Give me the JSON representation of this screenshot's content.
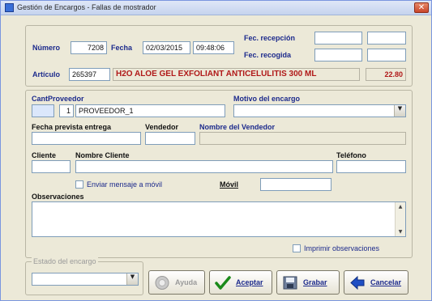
{
  "window": {
    "title": "Gestión de Encargos - Fallas de mostrador",
    "close_glyph": "✕"
  },
  "header": {
    "numero_label": "Número",
    "numero_value": "7208",
    "fecha_label": "Fecha",
    "fecha_date": "02/03/2015",
    "fecha_time": "09:48:06",
    "fec_recepcion_label": "Fec. recepción",
    "fec_recogida_label": "Fec. recogida",
    "articulo_label": "Artículo",
    "articulo_code": "265397",
    "articulo_desc": "H2O ALOE GEL EXFOLIANT ANTICELULITIS  300 ML",
    "articulo_price": "22.80"
  },
  "proveedor": {
    "cant_label": "Cant",
    "proveedor_label": "Proveedor",
    "proveedor_code": "1",
    "proveedor_name": "PROVEEDOR_1",
    "motivo_label": "Motivo del encargo",
    "motivo_value": "",
    "fecha_entrega_label": "Fecha prevista entrega",
    "vendedor_label": "Vendedor",
    "nombre_vendedor_label": "Nombre del Vendedor",
    "cliente_label": "Cliente",
    "nombre_cliente_label": "Nombre Cliente",
    "telefono_label": "Teléfono",
    "enviar_label": "Enviar mensaje a móvil",
    "movil_label": "Móvil",
    "observaciones_label": "Observaciones",
    "imprimir_label": "Imprimir observaciones"
  },
  "estado": {
    "label": "Estado del encargo",
    "value": ""
  },
  "buttons": {
    "ayuda": "Ayuda",
    "aceptar": "Aceptar",
    "grabar": "Grabar",
    "cancelar": "Cancelar"
  },
  "colors": {
    "label_blue": "#1c2a8c",
    "article_red": "#b01818",
    "window_bg": "#ece9d8"
  }
}
